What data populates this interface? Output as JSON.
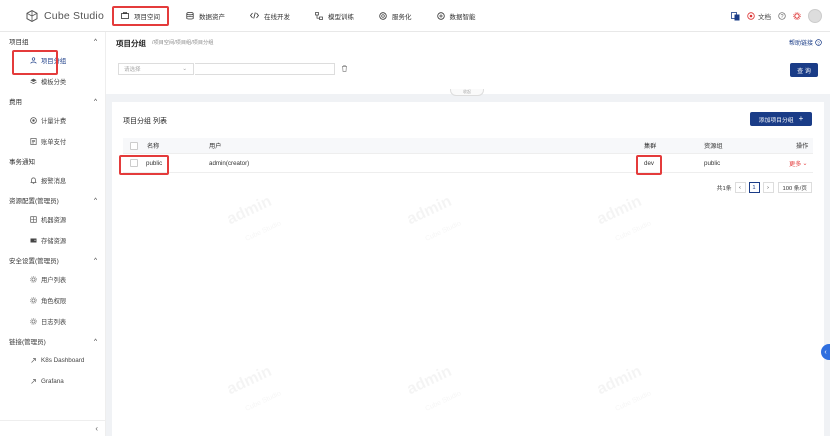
{
  "brand": {
    "name": "Cube Studio"
  },
  "nav": [
    {
      "id": "project",
      "label": "项目空间",
      "active": true,
      "icon": "briefcase-icon"
    },
    {
      "id": "data",
      "label": "数据资产",
      "active": false,
      "icon": "database-icon"
    },
    {
      "id": "dev",
      "label": "在线开发",
      "active": false,
      "icon": "code-icon"
    },
    {
      "id": "train",
      "label": "模型训练",
      "active": false,
      "icon": "flow-icon"
    },
    {
      "id": "serve",
      "label": "服务化",
      "active": false,
      "icon": "service-icon"
    },
    {
      "id": "ai",
      "label": "数据智能",
      "active": false,
      "icon": "brain-icon"
    }
  ],
  "top_right": {
    "lang_icon": "translate-icon",
    "doc_label": "文档",
    "doc_icon": "globe-icon",
    "help_icon": "question-icon",
    "settings_icon": "gear-icon"
  },
  "sidebar": [
    {
      "group": "项目组",
      "items": [
        {
          "label": "项目分组",
          "icon": "team-icon",
          "active": true
        },
        {
          "label": "模板分类",
          "icon": "layers-icon",
          "active": false
        }
      ]
    },
    {
      "group": "费用",
      "items": [
        {
          "label": "计量计费",
          "icon": "meter-icon",
          "active": false
        },
        {
          "label": "账单支付",
          "icon": "bill-icon",
          "active": false
        }
      ]
    },
    {
      "group": "事务通知",
      "items": [
        {
          "label": "报警消息",
          "icon": "alarm-icon",
          "active": false
        }
      ]
    },
    {
      "group": "资源配置(管理员)",
      "items": [
        {
          "label": "机器资源",
          "icon": "server-icon",
          "active": false
        },
        {
          "label": "存储资源",
          "icon": "storage-icon",
          "active": false
        }
      ]
    },
    {
      "group": "安全设置(管理员)",
      "items": [
        {
          "label": "用户列表",
          "icon": "user-gear-icon",
          "active": false
        },
        {
          "label": "角色权限",
          "icon": "role-gear-icon",
          "active": false
        },
        {
          "label": "日志列表",
          "icon": "log-gear-icon",
          "active": false
        }
      ]
    },
    {
      "group": "链接(管理员)",
      "items": [
        {
          "label": "K8s Dashboard",
          "icon": "link-icon",
          "active": false
        },
        {
          "label": "Grafana",
          "icon": "link-icon",
          "active": false
        }
      ]
    }
  ],
  "page": {
    "title": "项目分组",
    "breadcrumb": "/项目空间/项目组/项目分组",
    "help_label": "帮助链接",
    "filter_placeholder": "请选择",
    "query_label": "查 询",
    "toggle_label": "收起"
  },
  "table": {
    "title": "项目分组 列表",
    "add_label": "添加项目分组",
    "columns": [
      "名称",
      "用户",
      "集群",
      "资源组",
      "操作"
    ],
    "rows": [
      {
        "name": "public",
        "user": "admin(creator)",
        "cluster": "dev",
        "resource_group": "public",
        "action": "更多"
      }
    ],
    "pagination": {
      "total": "共1条",
      "current": "1",
      "page_size": "100 条/页"
    }
  },
  "watermark": {
    "text": "admin",
    "subtext": "Cube Studio"
  },
  "colors": {
    "primary": "#1a3c87",
    "highlight": "#e43b3b"
  }
}
